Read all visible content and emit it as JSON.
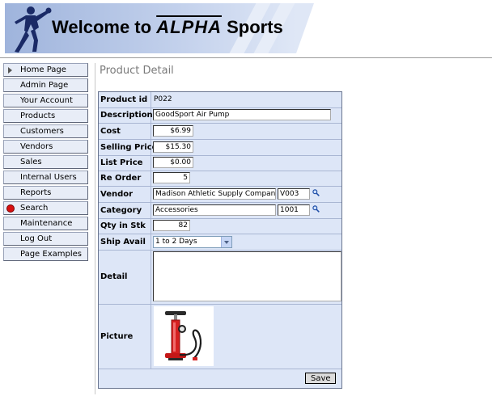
{
  "banner": {
    "title_prefix": "Welcome to ",
    "title_brand": "ALPHA",
    "title_suffix": " Sports"
  },
  "sidebar": {
    "items": [
      {
        "label": "Home Page",
        "marker": "arrow"
      },
      {
        "label": "Admin Page",
        "marker": ""
      },
      {
        "label": "Your Account",
        "marker": ""
      },
      {
        "label": "Products",
        "marker": ""
      },
      {
        "label": "Customers",
        "marker": ""
      },
      {
        "label": "Vendors",
        "marker": ""
      },
      {
        "label": "Sales",
        "marker": ""
      },
      {
        "label": "Internal Users",
        "marker": ""
      },
      {
        "label": "Reports",
        "marker": ""
      },
      {
        "label": "Search",
        "marker": "red-dot"
      },
      {
        "label": "Maintenance",
        "marker": ""
      },
      {
        "label": "Log Out",
        "marker": ""
      },
      {
        "label": "Page Examples",
        "marker": ""
      }
    ]
  },
  "page": {
    "title": "Product Detail"
  },
  "form": {
    "product_id": {
      "label": "Product id",
      "value": "P022"
    },
    "description": {
      "label": "Description",
      "value": "GoodSport Air Pump"
    },
    "cost": {
      "label": "Cost",
      "value": "$6.99"
    },
    "selling_price": {
      "label": "Selling Price",
      "value": "$15.30"
    },
    "list_price": {
      "label": "List Price",
      "value": "$0.00"
    },
    "re_order": {
      "label": "Re Order",
      "value": "5"
    },
    "vendor": {
      "label": "Vendor",
      "name": "Madison Athletic Supply Company",
      "code": "V003",
      "lookup_icon": "magnifier-icon"
    },
    "category": {
      "label": "Category",
      "name": "Accessories",
      "code": "1001",
      "lookup_icon": "magnifier-icon"
    },
    "qty_in_stock": {
      "label": "Qty in Stk",
      "value": "82"
    },
    "ship_avail": {
      "label": "Ship Avail",
      "selected": "1 to 2 Days"
    },
    "detail": {
      "label": "Detail",
      "value": ""
    },
    "picture": {
      "label": "Picture",
      "image": "red air pump"
    },
    "save_label": "Save"
  },
  "colors": {
    "form_bg": "#dde6f7",
    "nav_bg": "#e8edf7",
    "banner_blue": "#9fb4dc",
    "accent_red": "#d81010"
  }
}
